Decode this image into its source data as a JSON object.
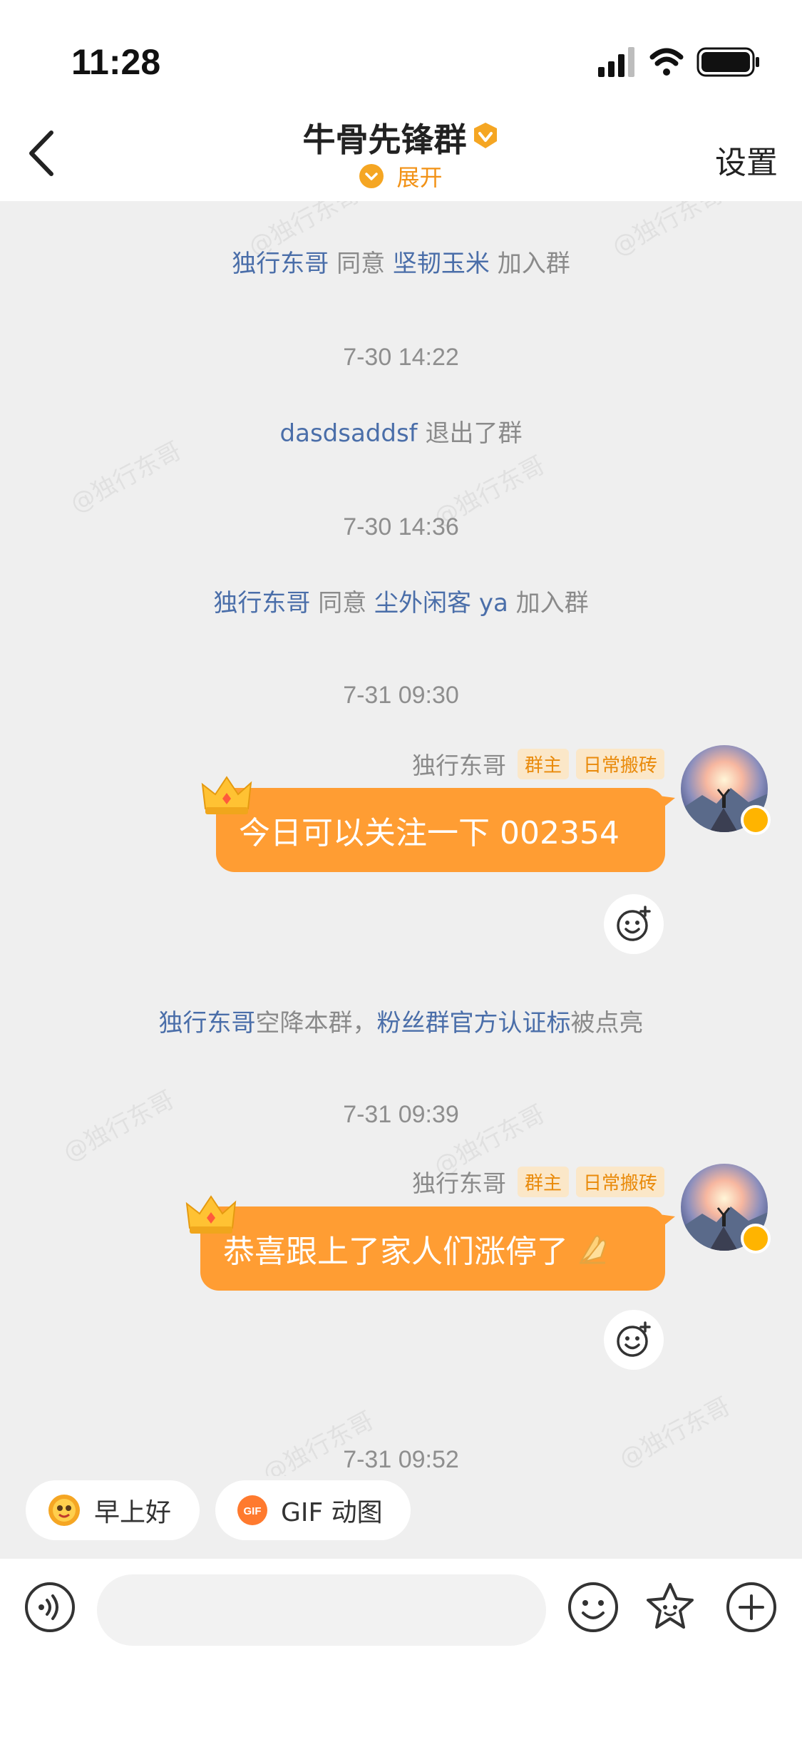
{
  "status": {
    "time": "11:28"
  },
  "nav": {
    "title": "牛骨先锋群",
    "expand_label": "展开",
    "settings_label": "设置"
  },
  "watermark_text": "@独行东哥",
  "messages": {
    "sys1": {
      "name1": "独行东哥",
      "text1": "同意",
      "name2": "坚韧玉米",
      "text2": "加入群"
    },
    "time1": "7-30 14:22",
    "sys2": {
      "name1": "dasdsaddsf",
      "text1": "退出了群"
    },
    "time2": "7-30 14:36",
    "sys3": {
      "name1": "独行东哥",
      "text1": "同意",
      "name2": "尘外闲客 ya",
      "text2": "加入群"
    },
    "time3": "7-31 09:30",
    "msg1": {
      "sender": "独行东哥",
      "badge_owner": "群主",
      "badge_title": "日常搬砖",
      "text": "今日可以关注一下 002354"
    },
    "sys4": {
      "name1": "独行东哥",
      "text1": "空降本群，",
      "name2": "粉丝群官方认证标",
      "text2": "被点亮"
    },
    "time4": "7-31 09:39",
    "msg2": {
      "sender": "独行东哥",
      "badge_owner": "群主",
      "badge_title": "日常搬砖",
      "text": "恭喜跟上了家人们涨停了"
    },
    "time5": "7-31 09:52"
  },
  "quick_replies": [
    {
      "label": "早上好",
      "icon": "sun-face-icon"
    },
    {
      "label": "GIF 动图",
      "icon": "gif-icon"
    }
  ],
  "input": {
    "placeholder": ""
  },
  "colors": {
    "accent": "#ff9d33",
    "name_link": "#4a6ea9",
    "chat_bg": "#efefef"
  }
}
